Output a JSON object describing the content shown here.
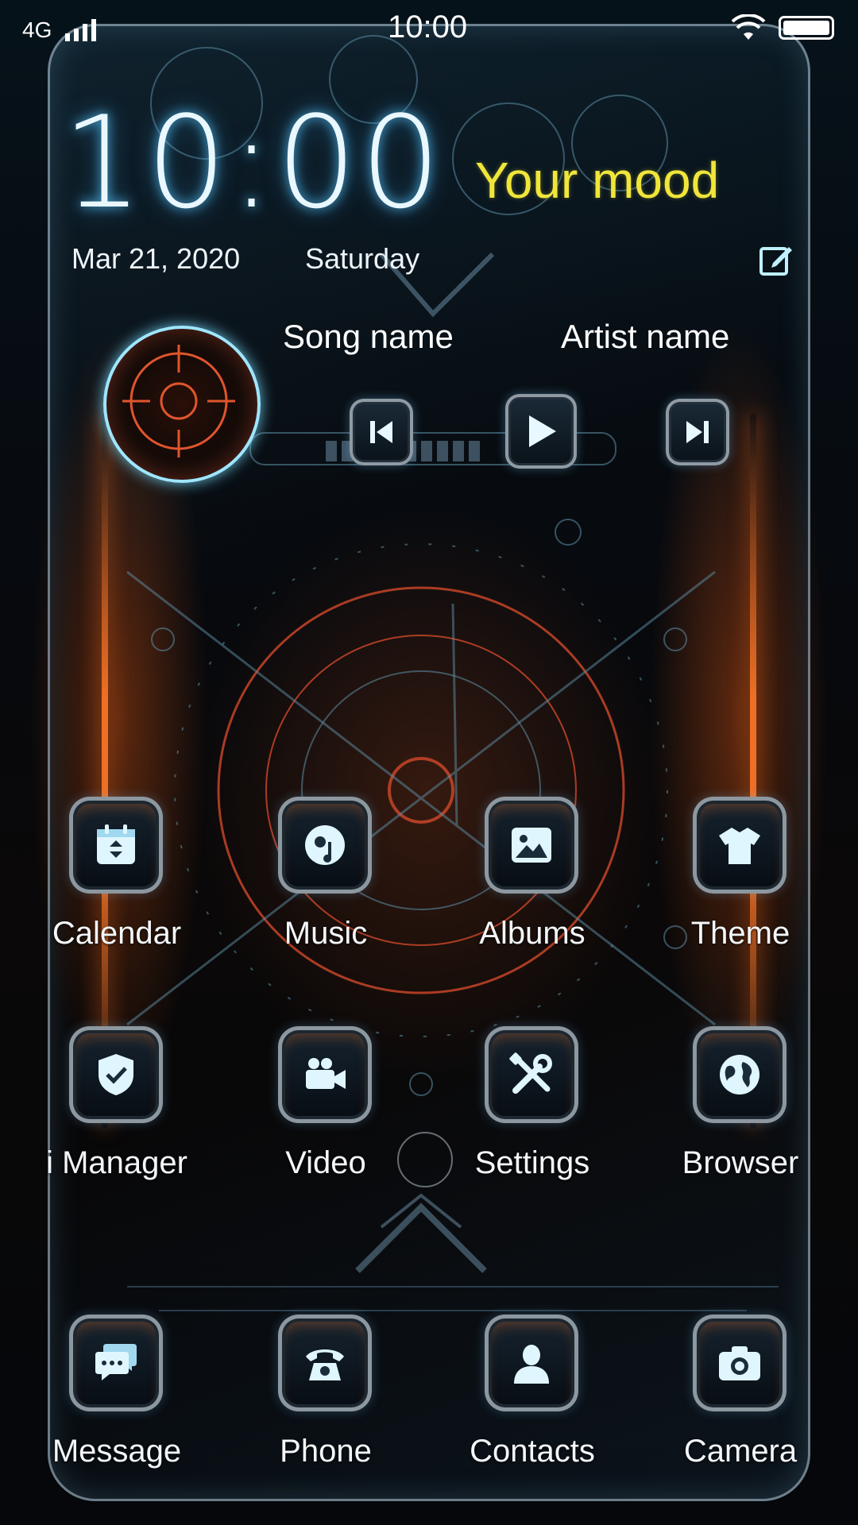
{
  "status_bar": {
    "network": "4G",
    "time": "10:00"
  },
  "widget": {
    "clock": "10:00",
    "mood": "Your mood",
    "date": "Mar 21, 2020",
    "weekday": "Saturday"
  },
  "music": {
    "song": "Song name",
    "artist": "Artist name"
  },
  "apps": {
    "row1": [
      {
        "label": "Calendar",
        "icon": "calendar-icon"
      },
      {
        "label": "Music",
        "icon": "music-disc-icon"
      },
      {
        "label": "Albums",
        "icon": "image-icon"
      },
      {
        "label": "Theme",
        "icon": "tshirt-icon"
      }
    ],
    "row2": [
      {
        "label": "i Manager",
        "icon": "shield-check-icon"
      },
      {
        "label": "Video",
        "icon": "video-camera-icon"
      },
      {
        "label": "Settings",
        "icon": "tools-icon"
      },
      {
        "label": "Browser",
        "icon": "globe-icon"
      }
    ],
    "dock": [
      {
        "label": "Message",
        "icon": "chat-bubble-icon"
      },
      {
        "label": "Phone",
        "icon": "phone-handset-icon"
      },
      {
        "label": "Contacts",
        "icon": "person-icon"
      },
      {
        "label": "Camera",
        "icon": "camera-icon"
      }
    ]
  },
  "colors": {
    "accent_cyan": "#9fe6ff",
    "mood_yellow": "#f0e63a",
    "glow_orange": "#ff7a28"
  }
}
